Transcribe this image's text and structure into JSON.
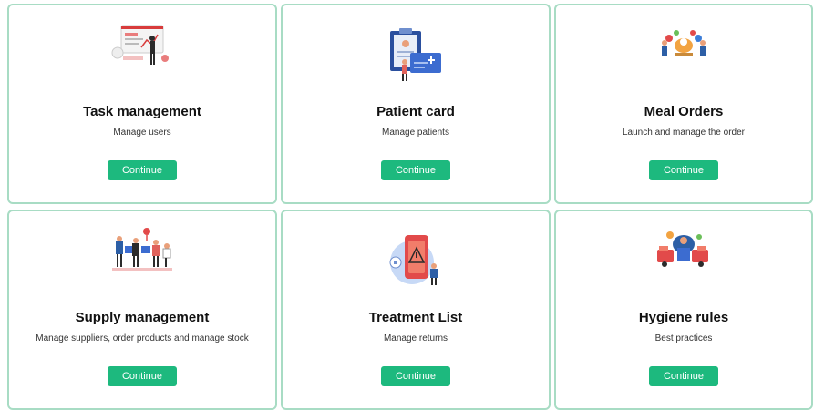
{
  "cards": [
    {
      "title": "Task management",
      "subtitle": "Manage users",
      "button": "Continue",
      "illustration": "task-management-illustration"
    },
    {
      "title": "Patient card",
      "subtitle": "Manage patients",
      "button": "Continue",
      "illustration": "patient-card-illustration"
    },
    {
      "title": "Meal Orders",
      "subtitle": "Launch and manage the order",
      "button": "Continue",
      "illustration": "meal-orders-illustration"
    },
    {
      "title": "Supply management",
      "subtitle": "Manage suppliers, order products and manage stock",
      "button": "Continue",
      "illustration": "supply-management-illustration"
    },
    {
      "title": "Treatment List",
      "subtitle": "Manage returns",
      "button": "Continue",
      "illustration": "treatment-list-illustration"
    },
    {
      "title": "Hygiene rules",
      "subtitle": "Best practices",
      "button": "Continue",
      "illustration": "hygiene-rules-illustration"
    }
  ],
  "colors": {
    "button": "#1db97e",
    "card_border": "#a8dcc4"
  }
}
